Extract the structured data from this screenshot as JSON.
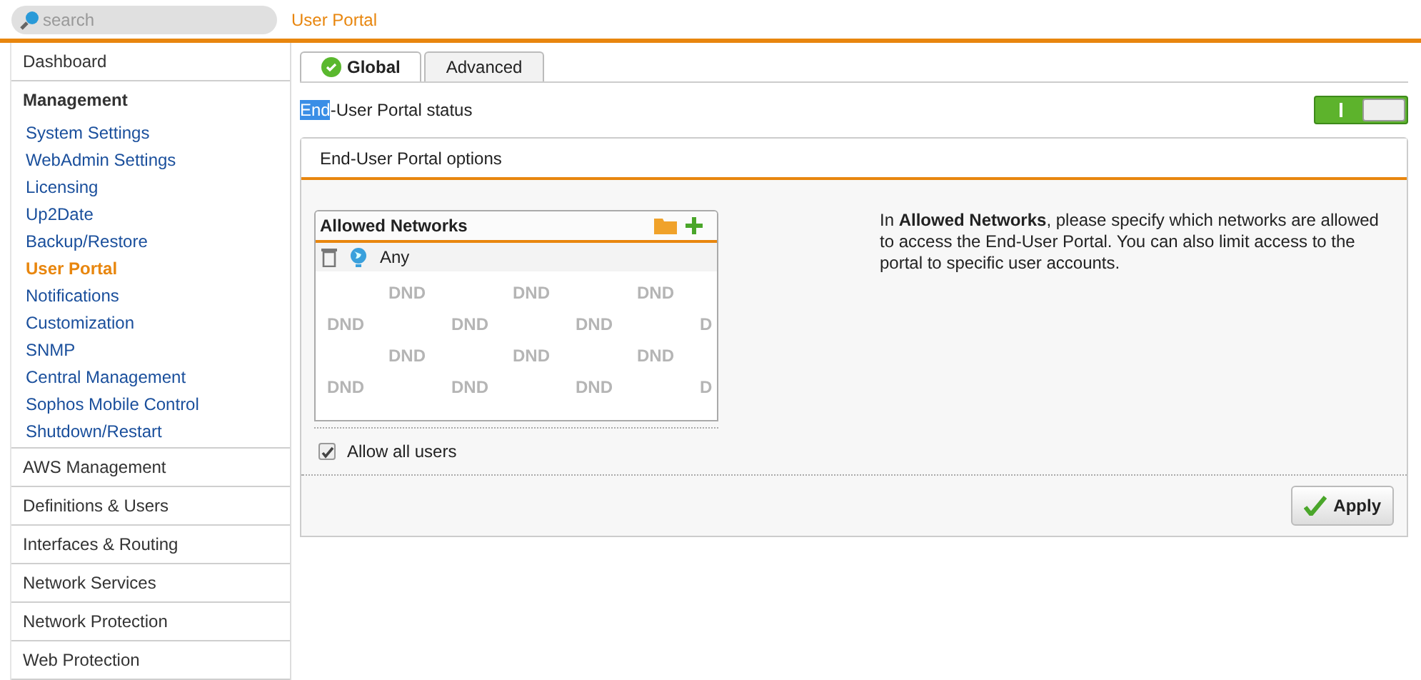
{
  "search": {
    "placeholder": "search"
  },
  "page_title": "User Portal",
  "sidebar": {
    "items": [
      {
        "label": "Dashboard",
        "expanded": false
      },
      {
        "label": "Management",
        "expanded": true,
        "children": [
          {
            "label": "System Settings",
            "selected": false
          },
          {
            "label": "WebAdmin Settings",
            "selected": false
          },
          {
            "label": "Licensing",
            "selected": false
          },
          {
            "label": "Up2Date",
            "selected": false
          },
          {
            "label": "Backup/Restore",
            "selected": false
          },
          {
            "label": "User Portal",
            "selected": true
          },
          {
            "label": "Notifications",
            "selected": false
          },
          {
            "label": "Customization",
            "selected": false
          },
          {
            "label": "SNMP",
            "selected": false
          },
          {
            "label": "Central Management",
            "selected": false
          },
          {
            "label": "Sophos Mobile Control",
            "selected": false
          },
          {
            "label": "Shutdown/Restart",
            "selected": false
          }
        ]
      },
      {
        "label": "AWS Management",
        "expanded": false
      },
      {
        "label": "Definitions & Users",
        "expanded": false
      },
      {
        "label": "Interfaces & Routing",
        "expanded": false
      },
      {
        "label": "Network Services",
        "expanded": false
      },
      {
        "label": "Network Protection",
        "expanded": false
      },
      {
        "label": "Web Protection",
        "expanded": false
      }
    ]
  },
  "tabs": [
    {
      "label": "Global",
      "selected": true
    },
    {
      "label": "Advanced",
      "selected": false
    }
  ],
  "status": {
    "highlighted": "End",
    "label": "-User Portal status",
    "on": true
  },
  "options_panel": {
    "title": "End-User Portal options",
    "networks": {
      "title": "Allowed Networks",
      "items": [
        {
          "label": "Any"
        }
      ],
      "drop_hints": [
        [
          "DND",
          "DND",
          "DND"
        ],
        [
          "DND",
          "DND",
          "DND",
          "D"
        ],
        [
          "DND",
          "DND",
          "DND"
        ],
        [
          "DND",
          "DND",
          "DND",
          "D"
        ]
      ]
    },
    "help": "In **Allowed Networks**, please specify which networks are allowed to access the End-User Portal. You can also limit access to the portal to specific user accounts.",
    "allow_all_users": {
      "label": "Allow all users",
      "checked": true
    },
    "apply": "Apply"
  }
}
